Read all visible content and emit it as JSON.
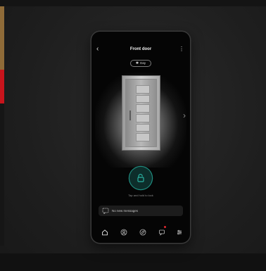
{
  "screen": {
    "title": "Front door",
    "tag": "Day"
  },
  "lock": {
    "hint": "Tap and hold to lock"
  },
  "messages": {
    "text": "No new messages"
  },
  "carousel": {
    "pages": 2,
    "active_page": 1
  },
  "nav": {
    "items": [
      "home-icon",
      "user-icon",
      "leaf-icon",
      "notifications-icon",
      "settings-icon"
    ]
  },
  "colors": {
    "accent": "#1f8a7d",
    "badge": "#e0282e"
  }
}
